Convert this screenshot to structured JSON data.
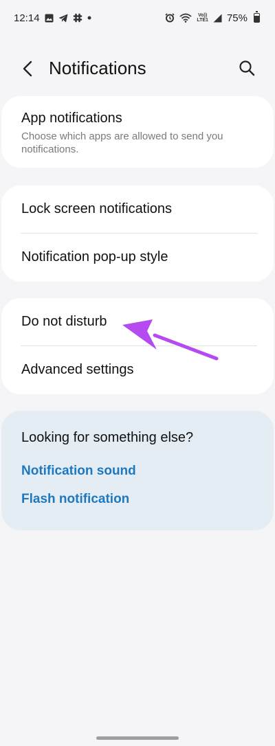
{
  "status_bar": {
    "time": "12:14",
    "battery": "75%",
    "battery_level": 0.75,
    "left_icons": [
      "gallery-icon",
      "telegram-icon",
      "slack-icon",
      "dot-icon"
    ],
    "right_icons": [
      "alarm-icon",
      "wifi-icon",
      "volte-icon",
      "signal-icon",
      "battery-icon"
    ],
    "volte_top": "Vo))",
    "volte_bottom": "LTE1"
  },
  "header": {
    "title": "Notifications",
    "back_icon": "chevron-left-icon",
    "search_icon": "search-icon"
  },
  "group1": {
    "app_notifications_title": "App notifications",
    "app_notifications_sub": "Choose which apps are allowed to send you notifications."
  },
  "group2": {
    "lock_screen": "Lock screen notifications",
    "popup_style": "Notification pop-up style"
  },
  "group3": {
    "do_not_disturb": "Do not disturb",
    "advanced": "Advanced settings"
  },
  "suggestions": {
    "heading": "Looking for something else?",
    "links": [
      "Notification sound",
      "Flash notification"
    ]
  },
  "colors": {
    "background": "#f5f5f7",
    "card": "#ffffff",
    "suggestion_card": "#e4edf3",
    "link": "#1e78c0",
    "annotation_arrow": "#b44af0"
  }
}
